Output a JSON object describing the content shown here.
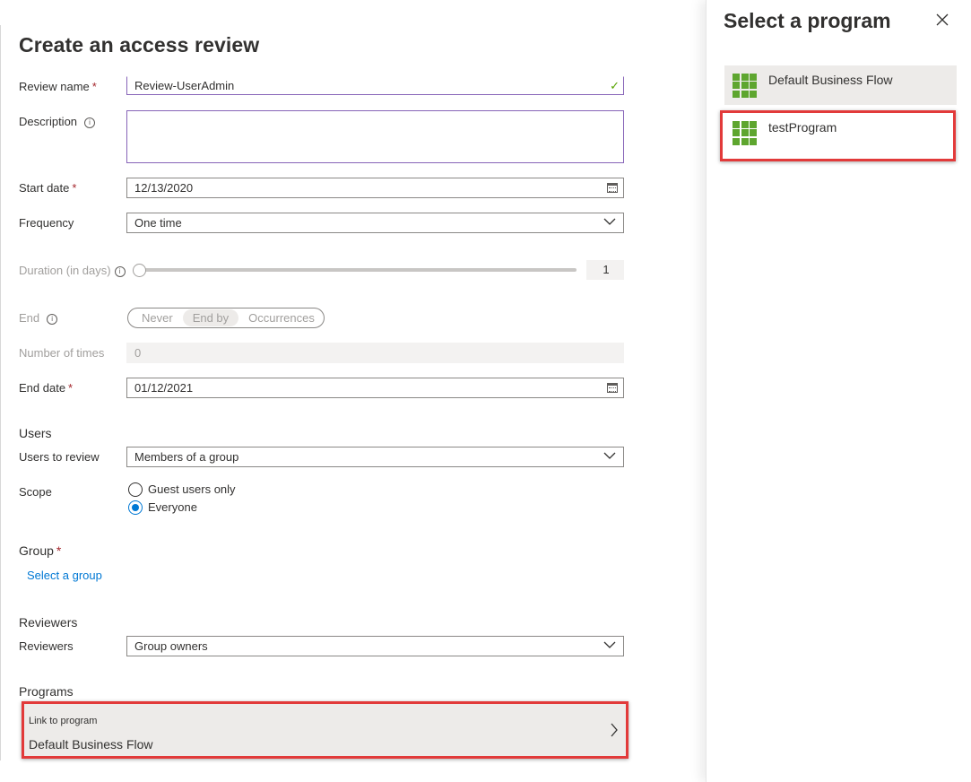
{
  "form": {
    "title": "Create an access review",
    "review_name": {
      "label": "Review name",
      "required": "*",
      "value": "Review-UserAdmin"
    },
    "description": {
      "label": "Description",
      "info": "i"
    },
    "start_date": {
      "label": "Start date",
      "required": "*",
      "value": "12/13/2020"
    },
    "frequency": {
      "label": "Frequency",
      "value": "One time"
    },
    "duration": {
      "label": "Duration (in days)",
      "info": "i",
      "value": "1",
      "level": 0
    },
    "end": {
      "label": "End",
      "info": "i",
      "options": [
        "Never",
        "End by",
        "Occurrences"
      ],
      "selected": "End by"
    },
    "number_of_times": {
      "label": "Number of times",
      "placeholder": "0"
    },
    "end_date": {
      "label": "End date",
      "required": "*",
      "value": "01/12/2021"
    },
    "users_section": "Users",
    "users_to_review": {
      "label": "Users to review",
      "value": "Members of a group"
    },
    "scope": {
      "label": "Scope",
      "options": [
        "Guest users only",
        "Everyone"
      ],
      "selected": "Everyone"
    },
    "group": {
      "label": "Group",
      "required": "*",
      "link": "Select a group"
    },
    "reviewers_section": "Reviewers",
    "reviewers": {
      "label": "Reviewers",
      "value": "Group owners"
    },
    "programs_section": "Programs",
    "link_to_program": {
      "label": "Link to program",
      "value": "Default Business Flow"
    }
  },
  "panel": {
    "title": "Select a program",
    "items": [
      {
        "label": "Default Business Flow",
        "icon": "program-grid-icon"
      },
      {
        "label": "testProgram",
        "icon": "program-grid-icon"
      }
    ]
  },
  "colors": {
    "accent": "#0078d4",
    "required": "#a4262c",
    "highlight_border": "#e23a3a",
    "valid_check": "#57a300",
    "program_icon": "#5ea62f"
  }
}
